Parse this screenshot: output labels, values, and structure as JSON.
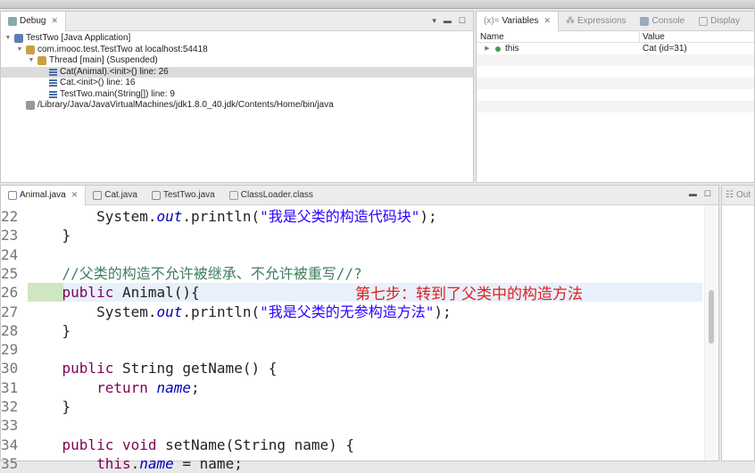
{
  "debug": {
    "tab": "Debug",
    "tree": [
      {
        "label": "TestTwo [Java Application]",
        "level": 0
      },
      {
        "label": "com.imooc.test.TestTwo at localhost:54418",
        "level": 1
      },
      {
        "label": "Thread [main] (Suspended)",
        "level": 2
      },
      {
        "label": "Cat(Animal).<init>() line: 26",
        "level": 3,
        "selected": true
      },
      {
        "label": "Cat.<init>() line: 16",
        "level": 3
      },
      {
        "label": "TestTwo.main(String[]) line: 9",
        "level": 3
      },
      {
        "label": "/Library/Java/JavaVirtualMachines/jdk1.8.0_40.jdk/Contents/Home/bin/java",
        "level": 1
      }
    ]
  },
  "variables": {
    "tabs": [
      "Variables",
      "Expressions",
      "Console",
      "Display"
    ],
    "col_name": "Name",
    "col_value": "Value",
    "rows": [
      {
        "name": "this",
        "value": "Cat  (id=31)"
      }
    ]
  },
  "editor": {
    "tabs": [
      "Animal.java",
      "Cat.java",
      "TestTwo.java",
      "ClassLoader.class"
    ],
    "outline_tab": "Out",
    "line_numbers": [
      "22",
      "23",
      "24",
      "25",
      "26",
      "27",
      "28",
      "29",
      "30",
      "31",
      "32",
      "33",
      "34",
      "35"
    ],
    "lines": {
      "l22a": "        System.",
      "l22b": "out",
      "l22c": ".println(",
      "l22d": "\"我是父类的构造代码块\"",
      "l22e": ");",
      "l23": "    }",
      "l25": "    //父类的构造不允许被继承、不允许被重写//?",
      "l26a": "    ",
      "l26b": "public",
      "l26c": " Animal(){",
      "l27a": "        System.",
      "l27b": "out",
      "l27c": ".println(",
      "l27d": "\"我是父类的无参构造方法\"",
      "l27e": ");",
      "l28": "    }",
      "l30a": "    ",
      "l30b": "public",
      "l30c": " String getName() {",
      "l31a": "        ",
      "l31b": "return",
      "l31c": " ",
      "l31d": "name",
      "l31e": ";",
      "l32": "    }",
      "l34a": "    ",
      "l34b": "public",
      "l34c": " ",
      "l34d": "void",
      "l34e": " setName(String name) {",
      "l35a": "        ",
      "l35b": "this",
      "l35c": ".",
      "l35d": "name",
      "l35e": " = name;"
    },
    "annotation": "第七步：转到了父类中的构造方法"
  }
}
